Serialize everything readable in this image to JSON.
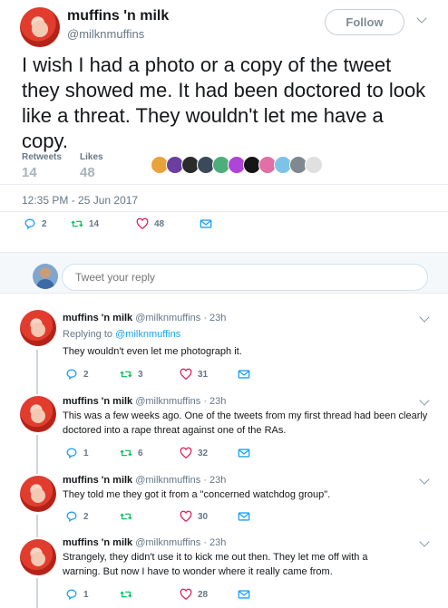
{
  "main_tweet": {
    "display_name": "muffins 'n milk",
    "handle": "@milknmuffins",
    "follow_label": "Follow",
    "text": "I wish I had a photo or a copy of the tweet they showed me. It had been doctored to look like a threat. They wouldn't let me have a copy.",
    "retweets_label": "Retweets",
    "retweets": "14",
    "likes_label": "Likes",
    "likes": "48",
    "timestamp": "12:35 PM - 25 Jun 2017",
    "actions": {
      "replies": "2",
      "retweets": "14",
      "likes": "48"
    }
  },
  "liker_colors": [
    "#e8a33b",
    "#6a3fa0",
    "#2b2b2b",
    "#3a4a5a",
    "#4caf7a",
    "#b044d6",
    "#161616",
    "#e26fa5",
    "#7dc3e8",
    "#808890",
    "#e0e0e0"
  ],
  "reply_box": {
    "placeholder": "Tweet your reply"
  },
  "replies": [
    {
      "name": "muffins 'n milk",
      "meta": "@milknmuffins · 23h",
      "replying_prefix": "Replying to",
      "replying_to": "@milknmuffins",
      "text": "They wouldn't even let me photograph it.",
      "replies": "2",
      "retweets": "3",
      "likes": "31"
    },
    {
      "name": "muffins 'n milk",
      "meta": "@milknmuffins · 23h",
      "text": "This was a few weeks ago. One of the tweets from my first thread had been clearly doctored into a rape threat against one of the RAs.",
      "replies": "1",
      "retweets": "6",
      "likes": "32"
    },
    {
      "name": "muffins 'n milk",
      "meta": "@milknmuffins · 23h",
      "text": "They told me they got it from a \"concerned watchdog group\".",
      "replies": "2",
      "retweets": "",
      "likes": "30"
    },
    {
      "name": "muffins 'n milk",
      "meta": "@milknmuffins · 23h",
      "text": "Strangely, they didn't use it to kick me out then. They let me off with a warning. But now I have to wonder where it really came from.",
      "replies": "1",
      "retweets": "",
      "likes": "28"
    }
  ]
}
